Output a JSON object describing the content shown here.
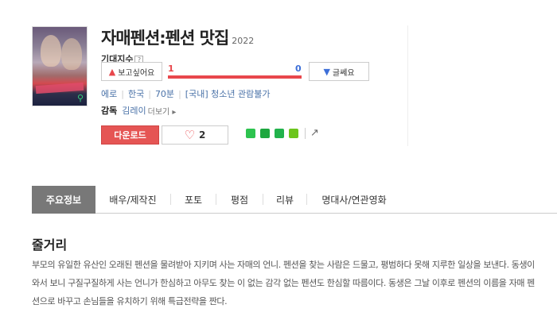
{
  "movie": {
    "title": "자매펜션:펜션 맛집",
    "year": "2022"
  },
  "expectation": {
    "label": "기대지수",
    "help": "?",
    "want_label": "보고싶어요",
    "hmm_label": "글쎄요",
    "want_count": "1",
    "hmm_count": "0",
    "want_ratio": 1.0
  },
  "meta": {
    "genre": "에로",
    "country": "한국",
    "runtime": "70분",
    "rating": "[국내] 청소년 관람불가"
  },
  "director": {
    "label": "감독",
    "name": "김레이",
    "more": "더보기 ▸"
  },
  "actions": {
    "download_label": "다운로드",
    "like_count": "2"
  },
  "tabs": [
    {
      "label": "주요정보"
    },
    {
      "label": "배우/제작진"
    },
    {
      "label": "포토"
    },
    {
      "label": "평점"
    },
    {
      "label": "리뷰"
    },
    {
      "label": "명대사/연관영화"
    }
  ],
  "synopsis": {
    "heading": "줄거리",
    "text": "부모의 유일한 유산인 오래된 펜션을 물려받아 지키며 사는 자매의 언니. 펜션을 찾는 사람은 드물고, 평범하다 못해 지루한 일상을 보낸다. 동생이 와서 보니 구질구질하게 사는 언니가 한심하고 아무도 찾는 이 없는 감각 없는 펜션도 한심할 따름이다. 동생은 그날 이후로 펜션의 이름을 자매 펜션으로 바꾸고 손님들을 유치하기 위해 특급전략을 짠다."
  },
  "colors": {
    "accent_red": "#e55554",
    "accent_blue": "#3d6fd8",
    "link_blue": "#4a72a8",
    "tab_active": "#787878"
  }
}
